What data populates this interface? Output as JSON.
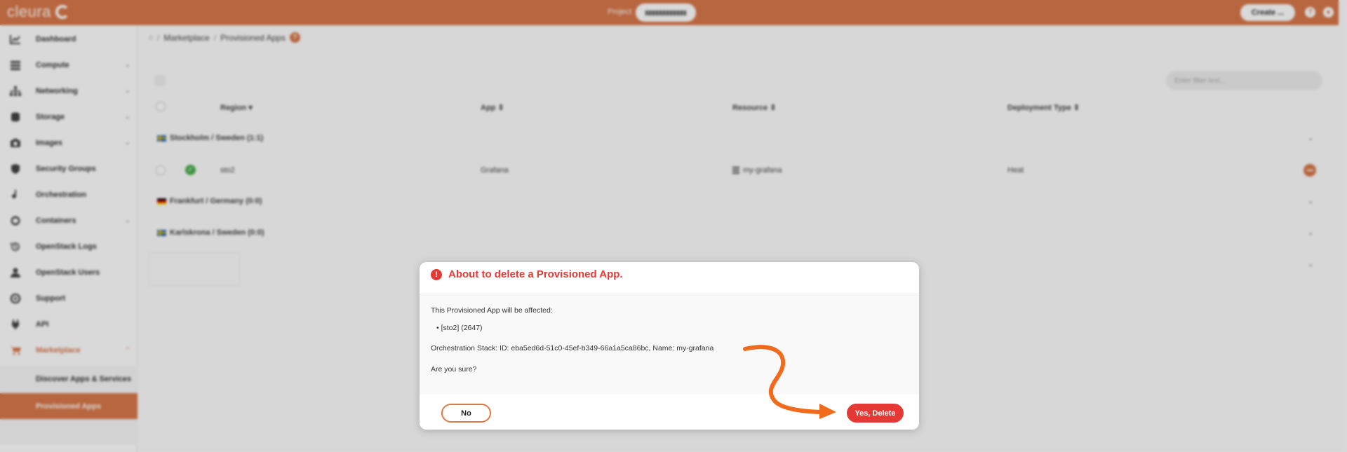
{
  "app": {
    "brand": "cleura",
    "project_label": "Project",
    "create_label": "Create ..."
  },
  "colors": {
    "accent": "#d9784a",
    "danger": "#e53935",
    "success": "#4caf50"
  },
  "sidebar": {
    "items": [
      {
        "label": "Dashboard",
        "icon": "dashboard-icon"
      },
      {
        "label": "Compute",
        "icon": "compute-icon"
      },
      {
        "label": "Networking",
        "icon": "networking-icon"
      },
      {
        "label": "Storage",
        "icon": "storage-icon"
      },
      {
        "label": "Images",
        "icon": "camera-icon"
      },
      {
        "label": "Security Groups",
        "icon": "shield-icon"
      },
      {
        "label": "Orchestration",
        "icon": "orchestration-icon"
      },
      {
        "label": "Containers",
        "icon": "containers-icon"
      },
      {
        "label": "OpenStack Logs",
        "icon": "history-icon"
      },
      {
        "label": "OpenStack Users",
        "icon": "user-icon"
      },
      {
        "label": "Support",
        "icon": "lifebuoy-icon"
      },
      {
        "label": "API",
        "icon": "plug-icon"
      },
      {
        "label": "Marketplace",
        "icon": "cart-icon"
      }
    ],
    "sub_items": [
      {
        "label": "Discover Apps & Services"
      },
      {
        "label": "Provisioned Apps"
      }
    ]
  },
  "breadcrumb": {
    "parent": "Marketplace",
    "current": "Provisioned Apps",
    "separator": "/"
  },
  "filter": {
    "placeholder": "Enter filter text..."
  },
  "table": {
    "columns": [
      "Region",
      "App",
      "Resource",
      "Deployment Type"
    ],
    "groups": [
      {
        "label": "Stockholm / Sweden (1:1)"
      },
      {
        "label": "Frankfurt / Germany (0:0)"
      },
      {
        "label": "Karlskrona / Sweden (0:0)"
      }
    ],
    "row": {
      "region": "sto2",
      "app": "Grafana",
      "resource": "my-grafana",
      "deployment_type": "Heat"
    }
  },
  "modal": {
    "title": "About to delete a Provisioned App.",
    "intro": "This Provisioned App will be affected:",
    "bullet": "[sto2] (2647)",
    "details": "Orchestration Stack: ID: eba5ed6d-51c0-45ef-b349-66a1a5ca86bc, Name: my-grafana",
    "question": "Are you sure?",
    "no_label": "No",
    "yes_label": "Yes, Delete"
  }
}
